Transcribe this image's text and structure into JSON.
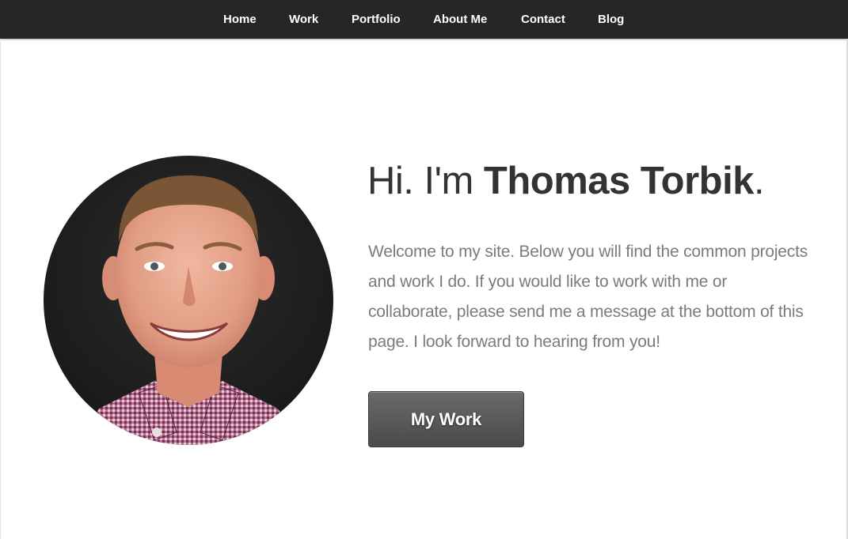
{
  "nav": {
    "items": [
      {
        "label": "Home"
      },
      {
        "label": "Work"
      },
      {
        "label": "Portfolio"
      },
      {
        "label": "About Me"
      },
      {
        "label": "Contact"
      },
      {
        "label": "Blog"
      }
    ]
  },
  "hero": {
    "greeting": "Hi. I'm ",
    "name": "Thomas Torbik",
    "period": ".",
    "intro": "Welcome to my site. Below you will find the common projects and work I do. If you would like to work with me or collaborate, please send me a message at the bottom of this page. I look forward to hearing from you!",
    "button_label": "My Work",
    "avatar_icon": "profile-photo"
  },
  "colors": {
    "nav_background": "#262626",
    "button_background": "#555555",
    "heading_text": "#333333",
    "body_text": "#7b7b7b"
  }
}
